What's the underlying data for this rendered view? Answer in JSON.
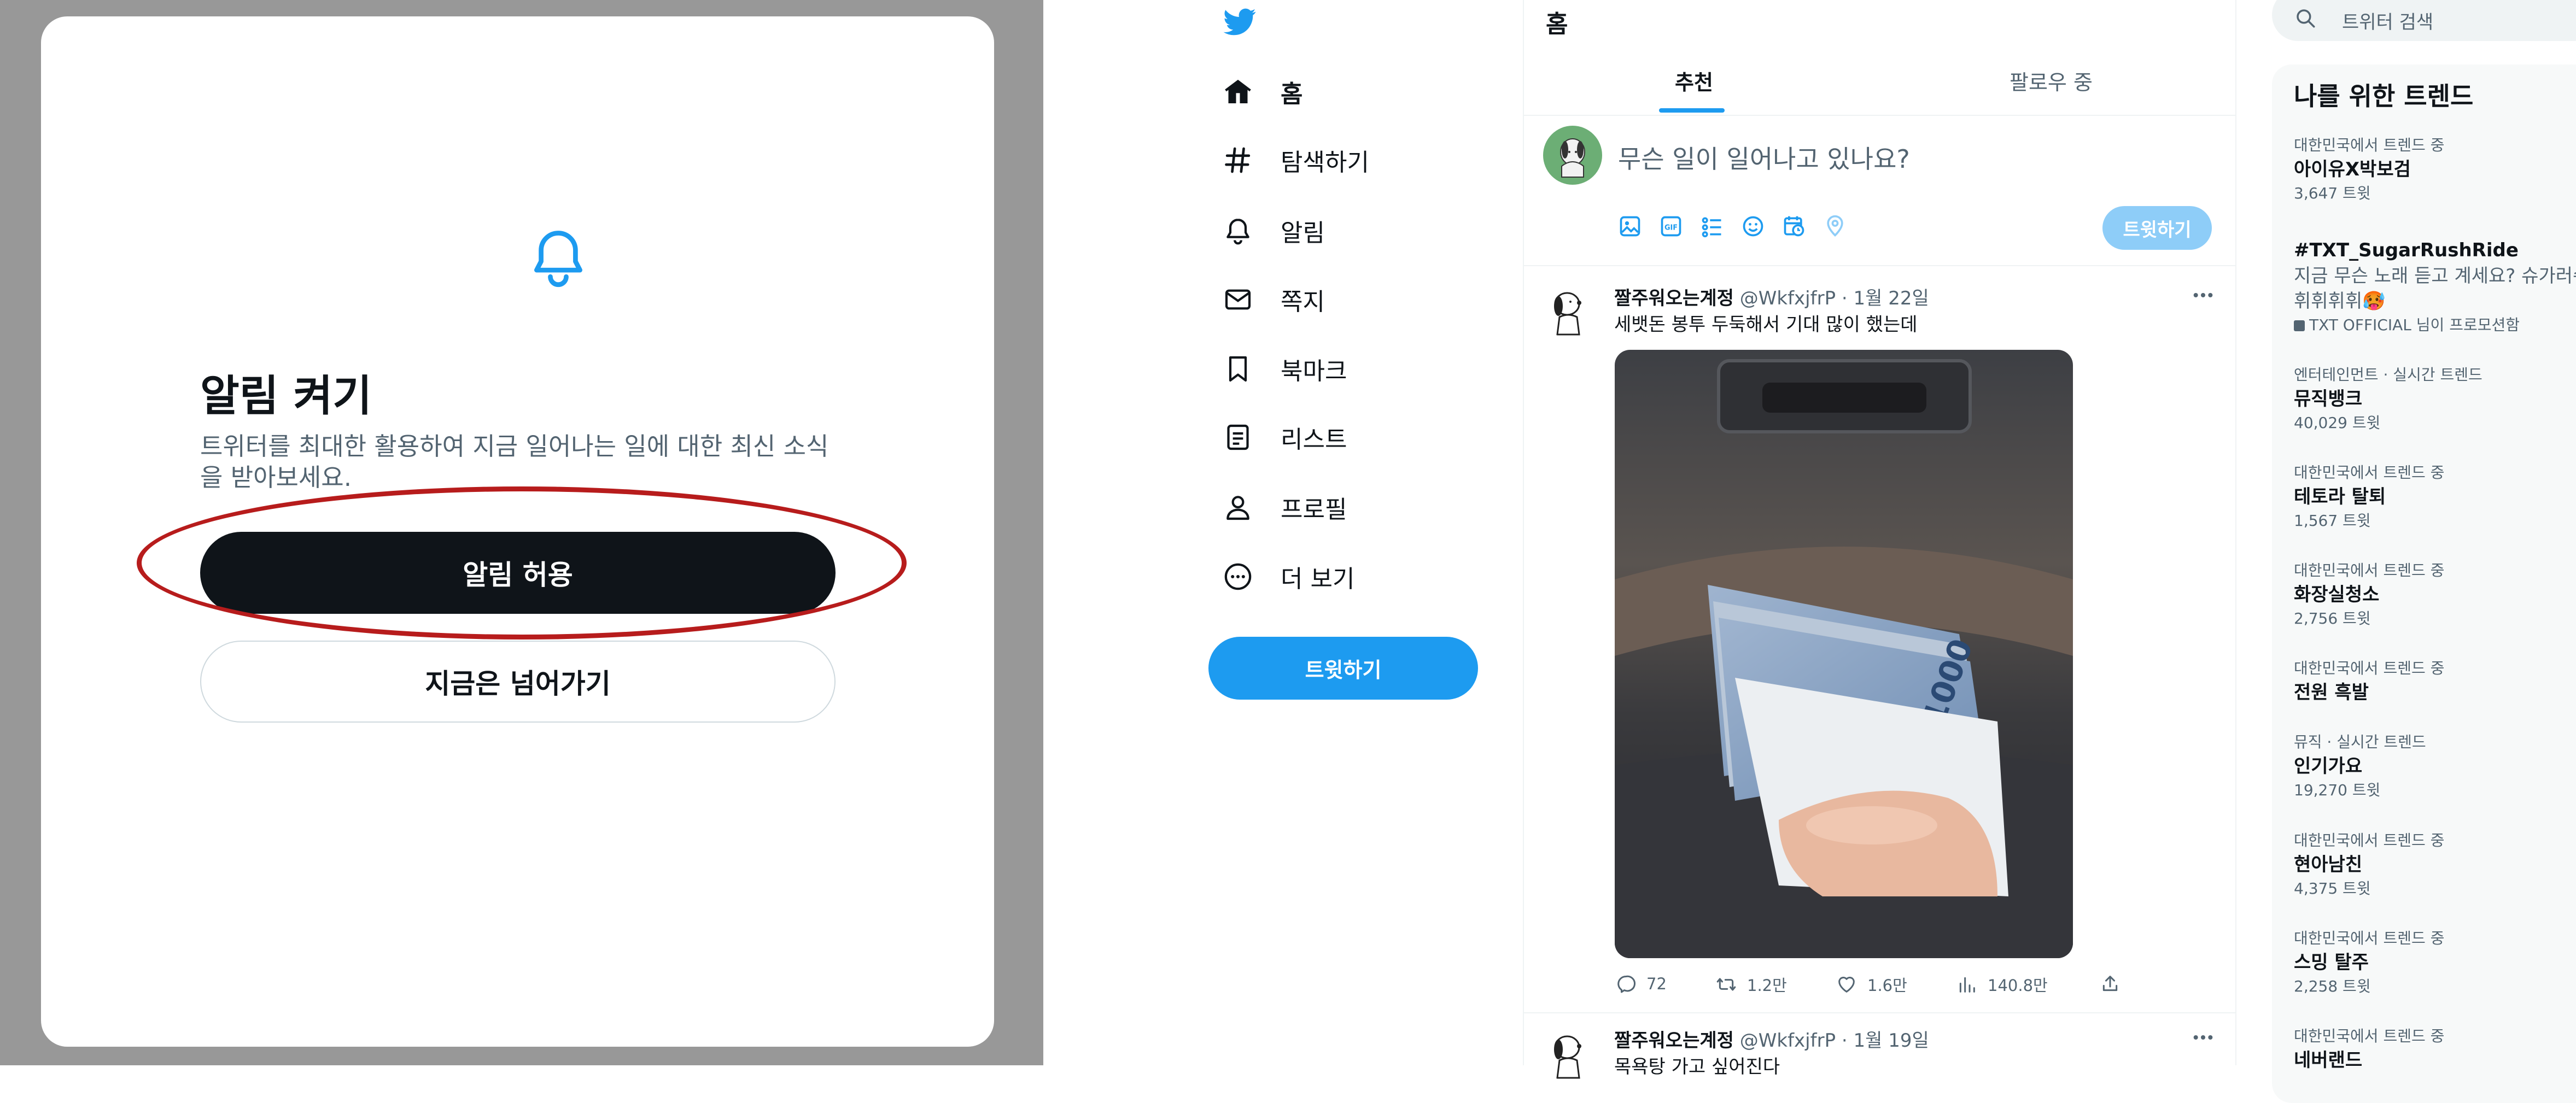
{
  "modal": {
    "title": "알림 켜기",
    "description": "트위터를 최대한 활용하여 지금 일어나는 일에 대한 최신 소식을 받아보세요.",
    "allow_label": "알림 허용",
    "skip_label": "지금은 넘어가기"
  },
  "sidebar": {
    "items": [
      {
        "label": "홈",
        "icon": "home-icon"
      },
      {
        "label": "탐색하기",
        "icon": "hashtag-icon"
      },
      {
        "label": "알림",
        "icon": "bell-icon"
      },
      {
        "label": "쪽지",
        "icon": "envelope-icon"
      },
      {
        "label": "북마크",
        "icon": "bookmark-icon"
      },
      {
        "label": "리스트",
        "icon": "list-icon"
      },
      {
        "label": "프로필",
        "icon": "person-icon"
      },
      {
        "label": "더 보기",
        "icon": "more-circle-icon"
      }
    ],
    "tweet_button": "트윗하기"
  },
  "main": {
    "title": "홈",
    "tabs": [
      "추천",
      "팔로우 중"
    ],
    "compose": {
      "placeholder": "무슨 일이 일어나고 있나요?",
      "submit": "트윗하기"
    },
    "tweets": [
      {
        "name": "짤주워오는계정",
        "handle": "@WkfxjfrP",
        "date": "· 1월 22일",
        "text": "세뱃돈 봉투 두둑해서 기대 많이 했는데",
        "replies": "72",
        "retweets": "1.2만",
        "likes": "1.6만",
        "views": "140.8만"
      },
      {
        "name": "짤주워오는계정",
        "handle": "@WkfxjfrP",
        "date": "· 1월 19일",
        "text": "목욕탕 가고 싶어진다"
      }
    ]
  },
  "right": {
    "search_placeholder": "트위터 검색",
    "trends_title": "나를 위한 트렌드",
    "trends": [
      {
        "context": "대한민국에서 트렌드 중",
        "name": "아이유X박보검",
        "count": "3,647 트윗"
      },
      {
        "name": "#TXT_SugarRushRide",
        "desc1": "지금 무슨 노래 듣고 계세요? 슈가러쉬",
        "desc2": "휘휘휘휘🥵",
        "promo": "TXT OFFICIAL 님이 프로모션함"
      },
      {
        "context": "엔터테인먼트 · 실시간 트렌드",
        "name": "뮤직뱅크",
        "count": "40,029 트윗"
      },
      {
        "context": "대한민국에서 트렌드 중",
        "name": "테토라 탈퇴",
        "count": "1,567 트윗"
      },
      {
        "context": "대한민국에서 트렌드 중",
        "name": "화장실청소",
        "count": "2,756 트윗"
      },
      {
        "context": "대한민국에서 트렌드 중",
        "name": "전원 흑발"
      },
      {
        "context": "뮤직 · 실시간 트렌드",
        "name": "인기가요",
        "count": "19,270 트윗"
      },
      {
        "context": "대한민국에서 트렌드 중",
        "name": "현아남친",
        "count": "4,375 트윗"
      },
      {
        "context": "대한민국에서 트렌드 중",
        "name": "스밍 탈주",
        "count": "2,258 트윗"
      },
      {
        "context": "대한민국에서 트렌드 중",
        "name": "네버랜드"
      }
    ]
  },
  "colors": {
    "accent": "#1d9bf0",
    "highlight": "#b71c1c",
    "overlay": "#989898"
  }
}
